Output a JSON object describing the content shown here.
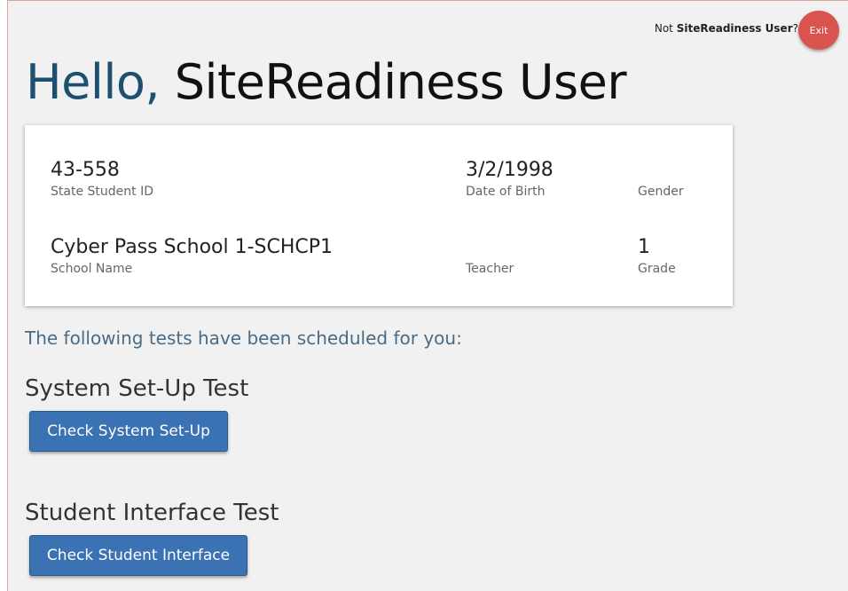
{
  "topbar": {
    "prefix": "Not",
    "user": "SiteReadiness User",
    "suffix": "?",
    "exit_label": "Exit"
  },
  "greeting": {
    "hello": "Hello,",
    "name": "SiteReadiness User"
  },
  "student": {
    "state_id": {
      "value": "43-558",
      "label": "State Student ID"
    },
    "dob": {
      "value": "3/2/1998",
      "label": "Date of Birth"
    },
    "gender": {
      "value": "",
      "label": "Gender"
    },
    "school": {
      "value": "Cyber Pass School 1-SCHCP1",
      "label": "School Name"
    },
    "teacher": {
      "value": "",
      "label": "Teacher"
    },
    "grade": {
      "value": "1",
      "label": "Grade"
    }
  },
  "schedule_text": "The following tests have been scheduled for you:",
  "tests": [
    {
      "title": "System Set-Up Test",
      "button": "Check System Set-Up"
    },
    {
      "title": "Student Interface Test",
      "button": "Check Student Interface"
    }
  ],
  "colors": {
    "accent_blue": "#1d4f70",
    "button_blue": "#3a72b3",
    "exit_red": "#d9534f"
  }
}
